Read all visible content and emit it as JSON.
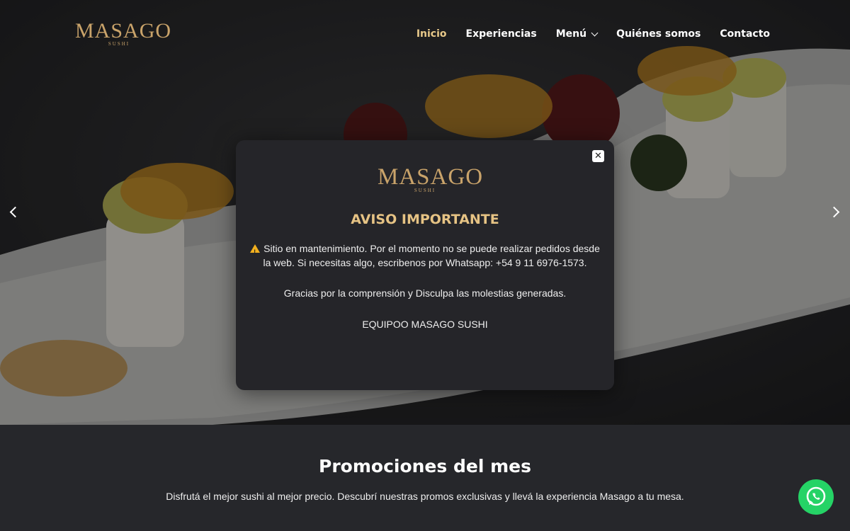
{
  "header": {
    "logo_text": "MASAGO",
    "logo_sub": "SUSHI",
    "nav": [
      {
        "label": "Inicio",
        "active": true
      },
      {
        "label": "Experiencias"
      },
      {
        "label": "Menú",
        "has_dropdown": true
      },
      {
        "label": "Quiénes somos"
      },
      {
        "label": "Contacto"
      }
    ]
  },
  "modal": {
    "logo_text": "MASAGO",
    "logo_sub": "SUSHI",
    "close_label": "✕",
    "title": "AVISO IMPORTANTE",
    "paragraph1": "Sitio en mantenimiento. Por el momento no se puede realizar pedidos desde la web. Si necesitas algo, escribenos por Whatsapp: +54 9 11 6976-1573.",
    "paragraph2": "Gracias por la comprensión y Disculpa las molestias generadas.",
    "paragraph3": "EQUIPOO MASAGO SUSHI"
  },
  "promo": {
    "title": "Promociones del mes",
    "text": "Disfrutá el mejor sushi al mejor precio. Descubrí nuestras promos exclusivas y llevá la experiencia Masago a tu mesa."
  },
  "colors": {
    "accent_gold": "#e6c384",
    "nav_active": "#e8c98a",
    "background": "#26272b",
    "whatsapp": "#25d366"
  },
  "icons": {
    "slider_prev": "chevron-left-icon",
    "slider_next": "chevron-right-icon",
    "modal_close": "close-icon",
    "warning": "warning-icon",
    "chat": "whatsapp-icon"
  }
}
